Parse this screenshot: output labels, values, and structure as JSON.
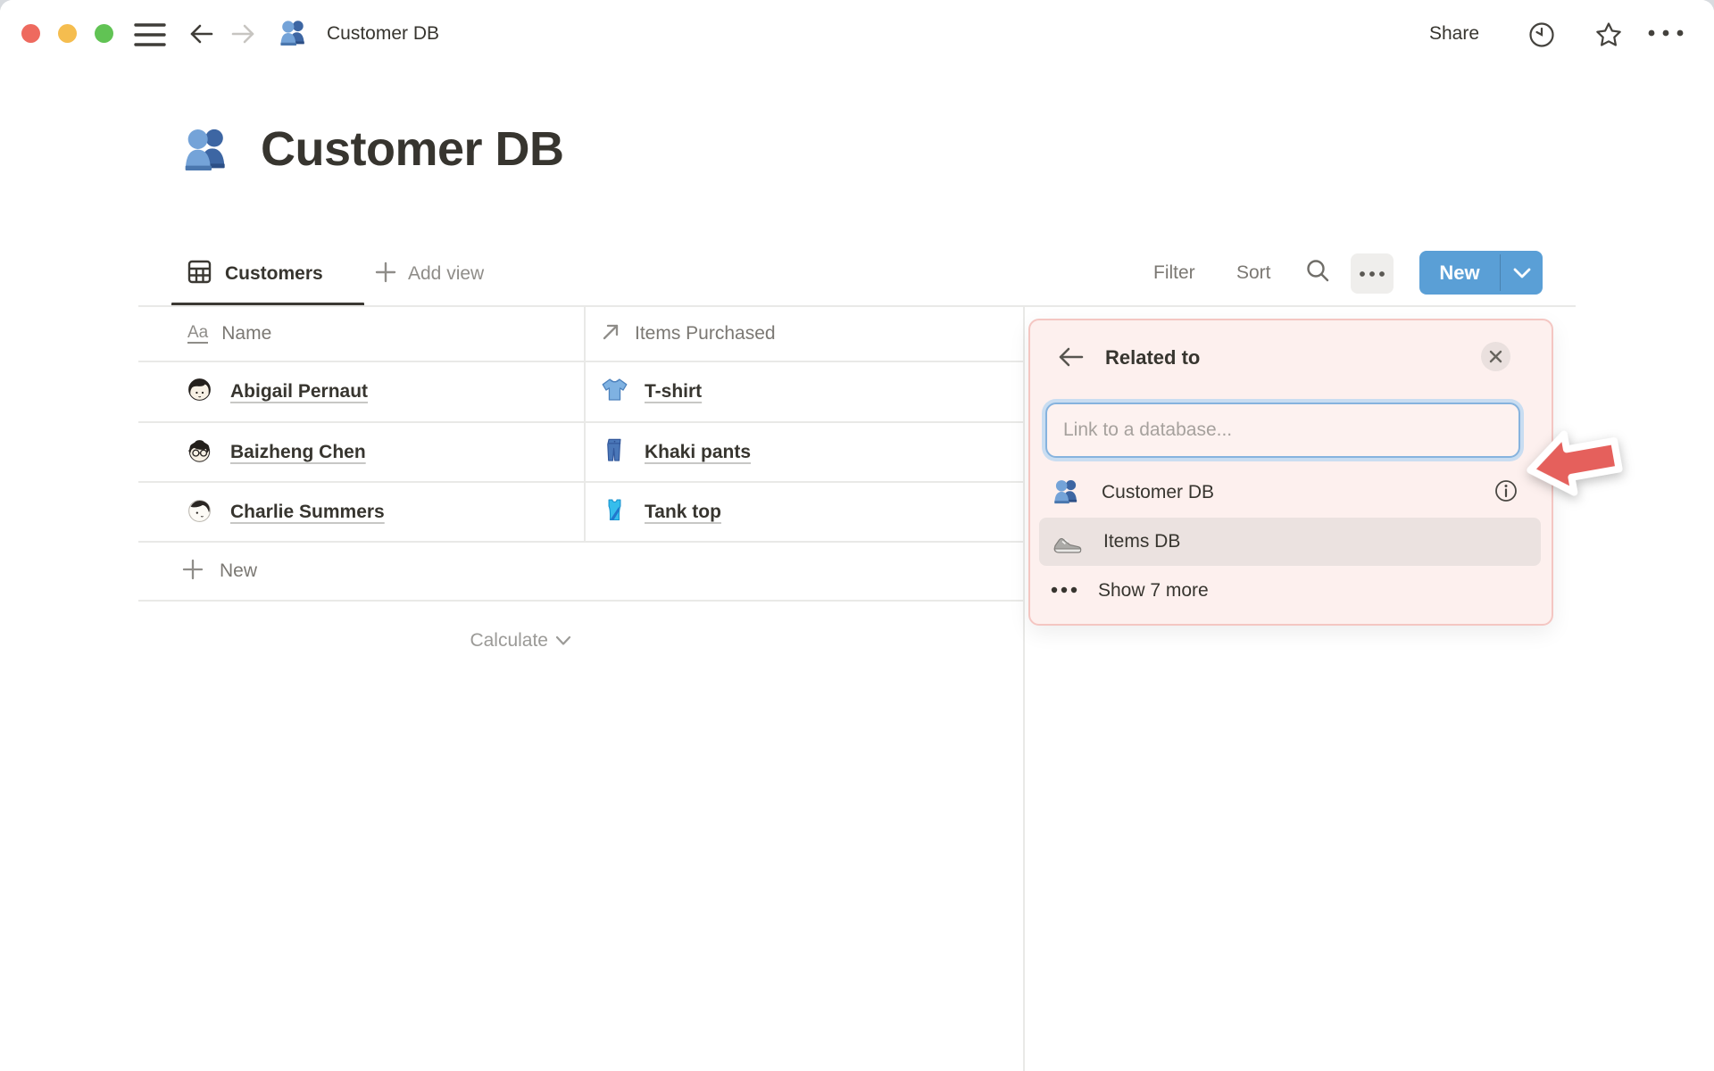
{
  "titlebar": {
    "doc_title": "Customer DB",
    "share_label": "Share"
  },
  "page_title": {
    "text": "Customer DB"
  },
  "view_bar": {
    "tab_label": "Customers",
    "add_view_label": "Add view",
    "filter_label": "Filter",
    "sort_label": "Sort",
    "new_label": "New"
  },
  "table": {
    "columns": [
      {
        "label": "Name"
      },
      {
        "label": "Items Purchased"
      }
    ],
    "rows": [
      {
        "name": "Abigail Pernaut",
        "item": "T-shirt"
      },
      {
        "name": "Baizheng Chen",
        "item": "Khaki pants"
      },
      {
        "name": "Charlie Summers",
        "item": "Tank top"
      }
    ],
    "new_row_label": "New",
    "calculate_label": "Calculate"
  },
  "related_popup": {
    "title": "Related to",
    "input_placeholder": "Link to a database...",
    "options": [
      {
        "label": "Customer DB"
      },
      {
        "label": "Items DB"
      }
    ],
    "show_more_label": "Show 7 more"
  },
  "icons": {
    "page_icon": "busts-in-silhouette",
    "items_db_icon": "running-shoe",
    "annotation": "red-left-arrow"
  },
  "colors": {
    "accent_blue": "#5a9fd6",
    "popup_bg": "#fdf0ee",
    "popup_border": "#f4c6c2",
    "highlight_row": "#ebe2e0",
    "arrow_red": "#e5605c",
    "traffic_red": "#ee6a5f",
    "traffic_yellow": "#f5bd4f",
    "traffic_green": "#61c354"
  }
}
